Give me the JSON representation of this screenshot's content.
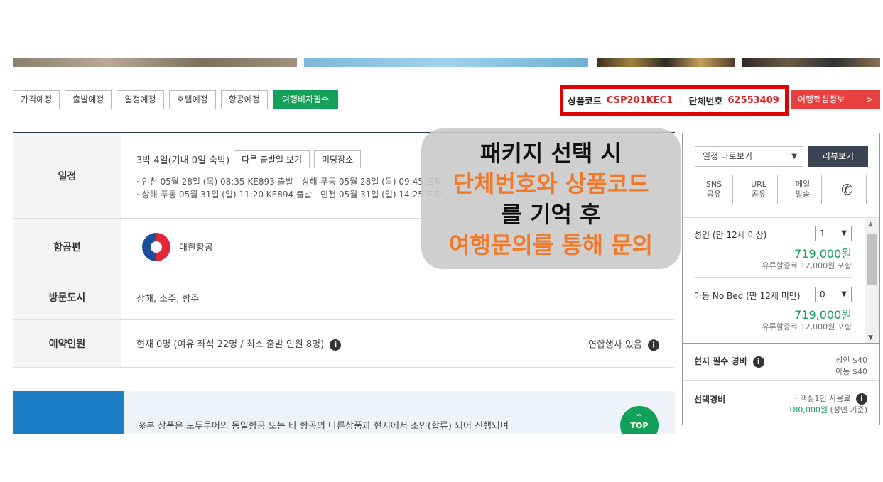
{
  "tabs": [
    "가격예정",
    "출발예정",
    "일정예정",
    "호텔예정",
    "항공예정",
    "여행비자필수"
  ],
  "product": {
    "code_label": "상품코드",
    "code_value": "CSP201KEC1",
    "group_label": "단체번호",
    "group_value": "62553409",
    "info_button": "여행핵심정보",
    "info_chevron": ">"
  },
  "schedule": {
    "label": "일정",
    "duration": "3박 4일(기내 0일 숙박)",
    "other_dates_button": "다른 출발일 보기",
    "meeting_button": "미팅장소",
    "outbound": "· 인천 05월 28일 (목) 08:35 KE893 출발 - 상해-푸동 05월 28일 (목) 09:45 도착",
    "inbound": "· 상해-푸동 05월 31일 (일) 11:20 KE894 출발 - 인천 05월 31일 (일) 14:25 도착"
  },
  "flight": {
    "label": "항공편",
    "airline": "대한항공"
  },
  "cities": {
    "label": "방문도시",
    "value": "상해, 소주, 항주"
  },
  "booking": {
    "label": "예약인원",
    "value": "현재 0명 (여유 좌석 22명 / 최소 출발 인원 8명)",
    "joint_note": "연합행사 있음",
    "info_icon": "i"
  },
  "notice": {
    "text": "※본 상품은 모두투어의 동일항공 또는 타 항공의 다른상품과 현지에서 조인(합류) 되어 진행되며"
  },
  "top_button": {
    "arrow": "^",
    "label": "TOP"
  },
  "overlay": {
    "line1": "패키지 선택 시",
    "line2": "단체번호와 상품코드",
    "line3": "를 기억 후",
    "line4": "여행문의를 통해 문의"
  },
  "side": {
    "schedule_select": "일정 바로보기",
    "review_button": "리뷰보기",
    "share_sns_1": "SNS",
    "share_sns_2": "공유",
    "share_url_1": "URL",
    "share_url_2": "공유",
    "share_mail_1": "메일",
    "share_mail_2": "발송",
    "phone_icon": "✆",
    "adult": {
      "label": "성인 (만 12세 이상)",
      "qty": "1",
      "price": "719,000원",
      "fuel": "유류할증료 12,000원 포함"
    },
    "child": {
      "label": "아동 No Bed (만 12세 미만)",
      "qty": "0",
      "price": "719,000원",
      "fuel": "유류할증료 12,000원 포함"
    },
    "local_fee": {
      "label": "현지 필수 경비",
      "adult": "성인 $40",
      "child": "아동 $40"
    },
    "optional_fee": {
      "label": "선택경비",
      "desc": "· 객실1인 사용료",
      "price": "180,000원",
      "note": "(성인 기준)"
    },
    "dropdown_arrow": "▼",
    "scroll_up": "▲",
    "scroll_down": "▼"
  },
  "colors": {
    "accent_green": "#12a05a",
    "accent_red": "#e84040",
    "highlight_border": "#e00000",
    "overlay_orange": "#f07a2a",
    "notice_blue": "#1c7cc4"
  }
}
